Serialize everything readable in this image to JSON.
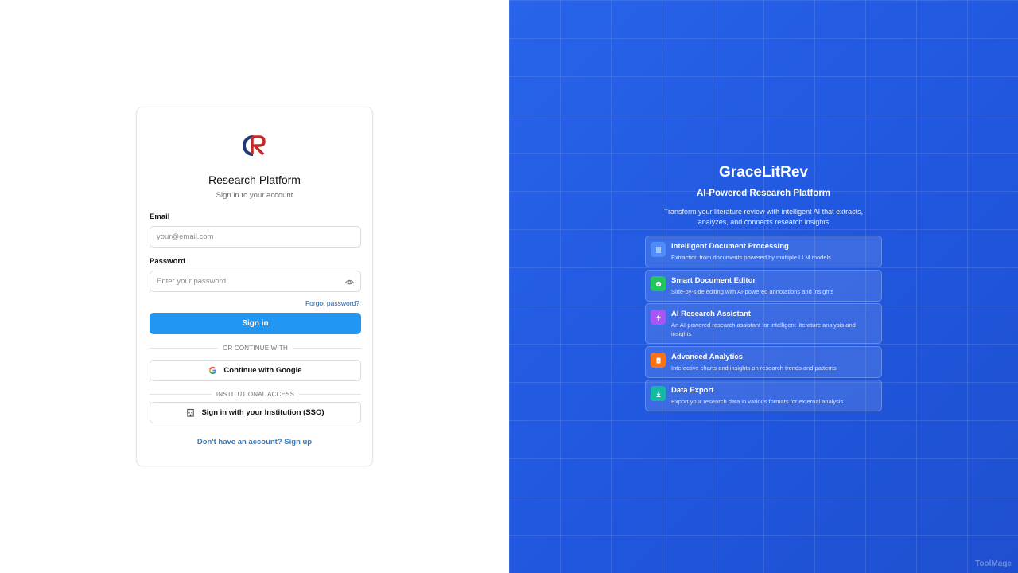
{
  "login": {
    "title": "Research Platform",
    "subtitle": "Sign in to your account",
    "email_label": "Email",
    "email_placeholder": "your@email.com",
    "password_label": "Password",
    "password_placeholder": "Enter your password",
    "forgot_label": "Forgot password?",
    "signin_label": "Sign in",
    "divider_continue": "OR CONTINUE WITH",
    "google_label": "Continue with Google",
    "divider_institution": "INSTITUTIONAL ACCESS",
    "sso_label": "Sign in with your Institution (SSO)",
    "signup_label": "Don't have an account? Sign up"
  },
  "hero": {
    "title": "GraceLitRev",
    "subtitle": "AI-Powered Research Platform",
    "description": "Transform your literature review with intelligent AI that extracts, analyzes, and connects research insights"
  },
  "features": [
    {
      "title": "Intelligent Document Processing",
      "desc": "Extraction from documents powered by multiple LLM models",
      "icon": "document-icon",
      "color": "#4f8df8"
    },
    {
      "title": "Smart Document Editor",
      "desc": "Side-by-side editing with AI-powered annotations and insights",
      "icon": "editor-icon",
      "color": "#22c55e"
    },
    {
      "title": "AI Research Assistant",
      "desc": "An AI-powered research assistant for intelligent literature analysis and insights",
      "icon": "lightning-icon",
      "color": "#a855f7"
    },
    {
      "title": "Advanced Analytics",
      "desc": "Interactive charts and insights on research trends and patterns",
      "icon": "analytics-icon",
      "color": "#f97316"
    },
    {
      "title": "Data Export",
      "desc": "Export your research data in various formats for external analysis",
      "icon": "download-icon",
      "color": "#14b8a6"
    }
  ],
  "colors": {
    "primary": "#2196f3",
    "link": "#1d5fa8",
    "hero_bg": "#2158e0"
  },
  "watermark": "ToolMage"
}
